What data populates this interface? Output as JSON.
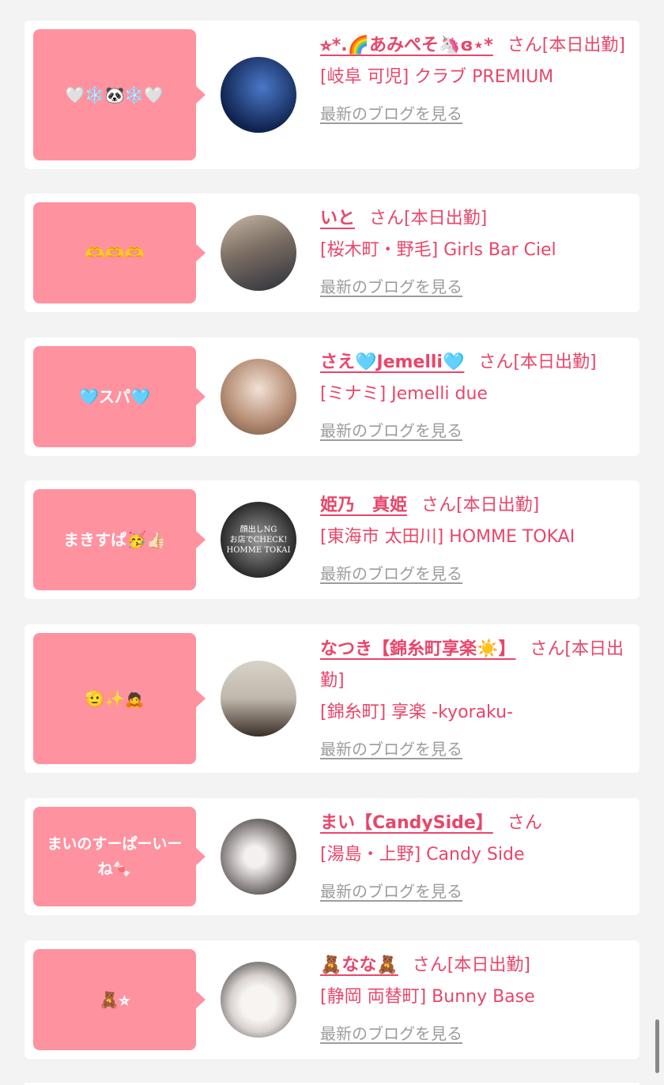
{
  "cards": [
    {
      "bubble": "🤍❄️🐼❄️🤍",
      "name": "⭐︎*.🌈あみぺそ🦄ɞ‪⋆*",
      "suffix": "さん[本日出勤]",
      "shop": "[岐阜 可児] クラブ PREMIUM",
      "blog": "最新のブログを見る",
      "colors": [
        "#10234f",
        "#4a78c8"
      ]
    },
    {
      "bubble": "🫶🫶🫶",
      "name": "いと",
      "suffix": "さん[本日出勤]",
      "shop": "[桜木町・野毛] Girls Bar Ciel",
      "blog": "最新のブログを見る",
      "colors": [
        "#2b2f3a",
        "#b8a898"
      ]
    },
    {
      "bubble": "🩵スパ🩵",
      "name": "さえ🩵Jemelli🩵",
      "suffix": "さん[本日出勤]",
      "shop": "[ミナミ] Jemelli due",
      "blog": "最新のブログを見る",
      "colors": [
        "#e9d6c8",
        "#8a6a54"
      ]
    },
    {
      "bubble": "まきすぱ🥳👍🏻",
      "name": "姫乃　真姫",
      "suffix": "さん[本日出勤]",
      "shop": "[東海市 太田川] HOMME TOKAI",
      "blog": "最新のブログを見る",
      "avatar_text": "顔出しNG\nお店でCHECK!\nHOMME TOKAI",
      "colors": [
        "#1b1b1b",
        "#8a8a8a"
      ]
    },
    {
      "bubble": "🫡✨🙇",
      "name": "なつき【錦糸町享楽☀️】",
      "suffix": "さん[本日出勤]",
      "shop": "[錦糸町] 享楽 -kyoraku-",
      "blog": "最新のブログを見る",
      "colors": [
        "#cfc8be",
        "#3a2e28"
      ]
    },
    {
      "bubble": "まいのすーぱーいーね🍬",
      "name": "まい【CandySide】",
      "suffix": "さん",
      "shop": "[湯島・上野] Candy Side",
      "blog": "最新のブログを見る",
      "colors": [
        "#d8d4d4",
        "#2a2422"
      ]
    },
    {
      "bubble": "🧸⭐︎",
      "name": "🧸なな🧸",
      "suffix": "さん[本日出勤]",
      "shop": "[静岡 両替町] Bunny Base",
      "blog": "最新のブログを見る",
      "colors": [
        "#f5f3f2",
        "#2b2b2b"
      ]
    }
  ]
}
